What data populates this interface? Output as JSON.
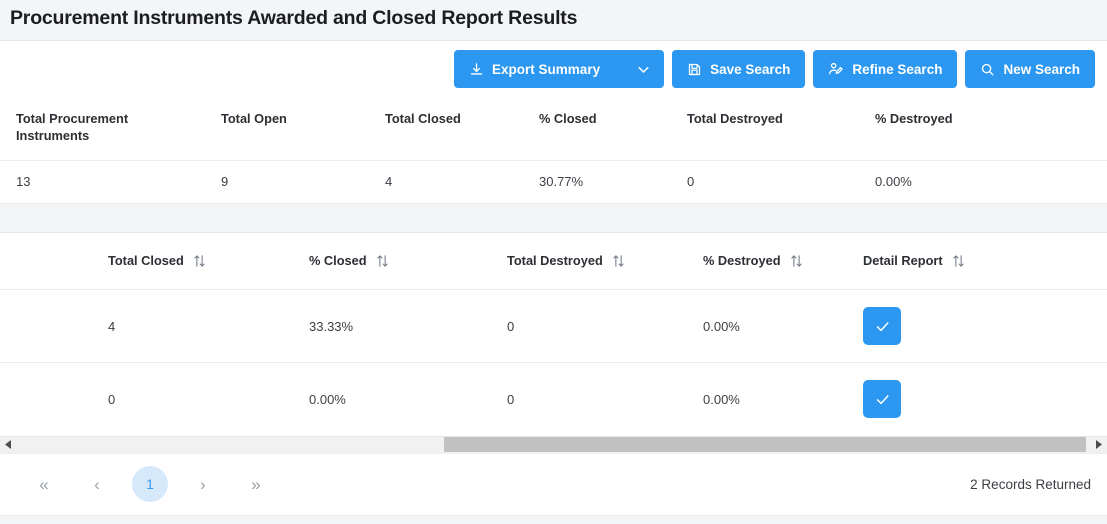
{
  "page_title": "Procurement Instruments Awarded and Closed Report Results",
  "theme": {
    "accent": "#2b97f0",
    "page_background": "#f4f5f6",
    "card_background": "#ffffff",
    "current_page_background": "#d6e9fb",
    "scroll_thumb": "#c1c1c1"
  },
  "toolbar": {
    "export_summary_label": "Export Summary",
    "export_summary_icon": "download-icon",
    "export_summary_caret_icon": "chevron-down-icon",
    "save_search_label": "Save Search",
    "save_search_icon": "save-floppy-icon",
    "refine_search_label": "Refine Search",
    "refine_search_icon": "user-edit-icon",
    "new_search_label": "New Search",
    "new_search_icon": "search-icon"
  },
  "summary_table": {
    "columns": [
      "Total Procurement Instruments",
      "Total Open",
      "Total Closed",
      "% Closed",
      "Total Destroyed",
      "% Destroyed"
    ],
    "row": [
      "13",
      "9",
      "4",
      "30.77%",
      "0",
      "0.00%"
    ]
  },
  "detail_table": {
    "columns": [
      {
        "label": "Total Closed",
        "sort_icon": "sort-updown-icon"
      },
      {
        "label": "% Closed",
        "sort_icon": "sort-updown-icon"
      },
      {
        "label": "Total Destroyed",
        "sort_icon": "sort-updown-icon"
      },
      {
        "label": "% Destroyed",
        "sort_icon": "sort-updown-icon"
      },
      {
        "label": "Detail Report",
        "sort_icon": "sort-updown-icon"
      }
    ],
    "rows": [
      {
        "total_closed": "4",
        "pct_closed": "33.33%",
        "total_destroyed": "0",
        "pct_destroyed": "0.00%",
        "detail_report_icon": "check-icon"
      },
      {
        "total_closed": "0",
        "pct_closed": "0.00%",
        "total_destroyed": "0",
        "pct_destroyed": "0.00%",
        "detail_report_icon": "check-icon"
      }
    ]
  },
  "scrollbar": {
    "left_arrow_icon": "triangle-left-icon",
    "right_arrow_icon": "triangle-right-icon"
  },
  "pagination": {
    "first_label": "«",
    "prev_label": "‹",
    "current_page": "1",
    "next_label": "›",
    "last_label": "»",
    "records_returned": "2 Records Returned"
  }
}
